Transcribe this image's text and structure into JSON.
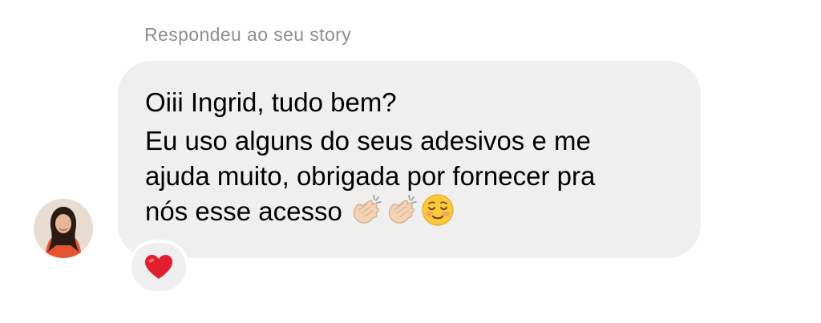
{
  "context_label": "Respondeu ao seu story",
  "message": {
    "line1": "Oiii Ingrid, tudo bem?",
    "line2": "Eu uso alguns do seus adesivos e me",
    "line3": "ajuda muito, obrigada por fornecer pra",
    "line4_text": "nós esse acesso",
    "emojis": [
      "clapping-hands-icon",
      "clapping-hands-icon",
      "smiling-face-icon"
    ]
  },
  "reaction": {
    "icon": "red-heart-icon",
    "color": "#e0202e"
  },
  "colors": {
    "bubble": "#efefef",
    "label": "#8e8e8e",
    "text": "#000000"
  }
}
